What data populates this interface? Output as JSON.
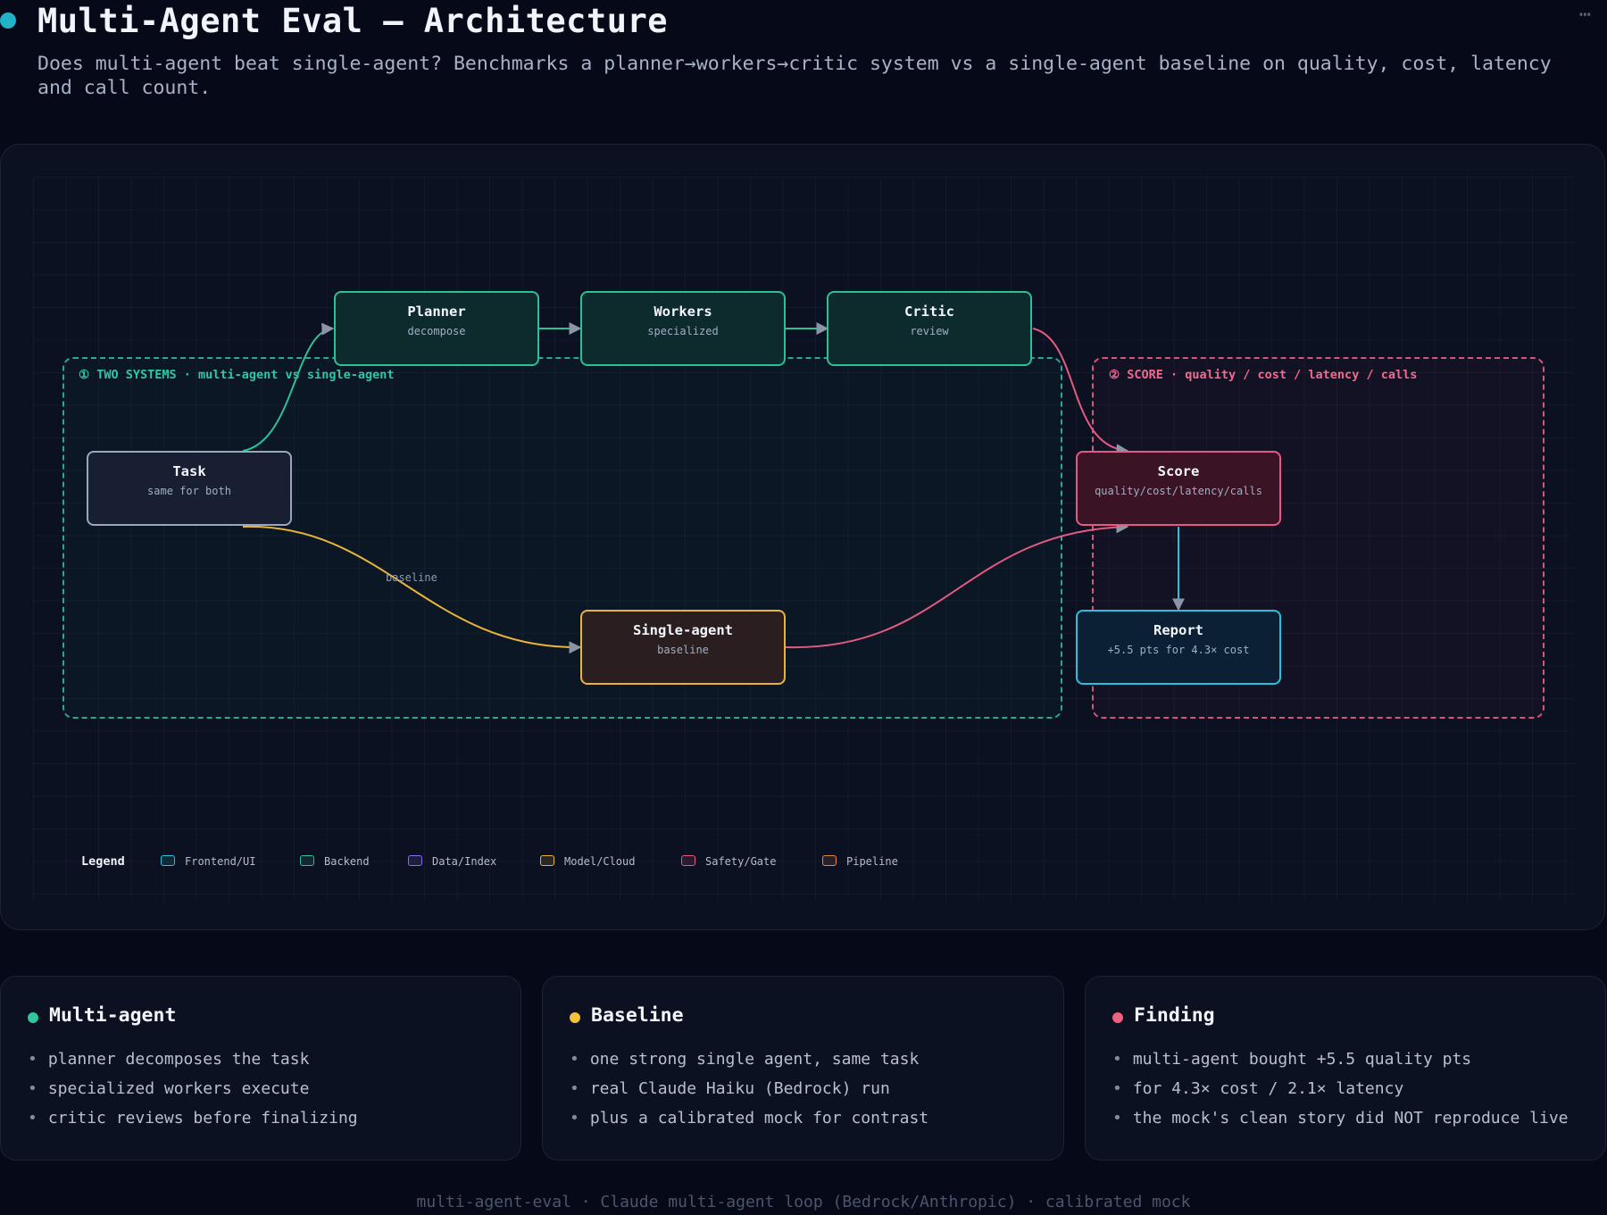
{
  "header": {
    "title": "Multi-Agent Eval — Architecture",
    "subtitle": "Does multi-agent beat single-agent? Benchmarks a planner→workers→critic system vs a single-agent baseline on quality, cost, latency and call count.",
    "more_icon": "⋯"
  },
  "zones": {
    "systems": "① TWO SYSTEMS · multi-agent vs single-agent",
    "score": "② SCORE · quality / cost / latency / calls"
  },
  "nodes": {
    "planner": {
      "title": "Planner",
      "sub": "decompose"
    },
    "workers": {
      "title": "Workers",
      "sub": "specialized"
    },
    "critic": {
      "title": "Critic",
      "sub": "review"
    },
    "task": {
      "title": "Task",
      "sub": "same for both"
    },
    "single": {
      "title": "Single-agent",
      "sub": "baseline"
    },
    "score": {
      "title": "Score",
      "sub": "quality/cost/latency/calls"
    },
    "report": {
      "title": "Report",
      "sub": "+5.5 pts for 4.3× cost"
    }
  },
  "edge_labels": {
    "baseline": "baseline"
  },
  "legend": {
    "title": "Legend",
    "items": [
      {
        "label": "Frontend/UI",
        "color": "#2bc0dd"
      },
      {
        "label": "Backend",
        "color": "#2fbf96"
      },
      {
        "label": "Data/Index",
        "color": "#8b6fe8"
      },
      {
        "label": "Model/Cloud",
        "color": "#e8b43a"
      },
      {
        "label": "Safety/Gate",
        "color": "#e55a80"
      },
      {
        "label": "Pipeline",
        "color": "#e08a4a"
      }
    ]
  },
  "cards": [
    {
      "title": "Multi-agent",
      "color": "#2fc7a0",
      "items": [
        "planner decomposes the task",
        "specialized workers execute",
        "critic reviews before finalizing"
      ]
    },
    {
      "title": "Baseline",
      "color": "#f2c43c",
      "items": [
        "one strong single agent, same task",
        "real Claude Haiku (Bedrock) run",
        "plus a calibrated mock for contrast"
      ]
    },
    {
      "title": "Finding",
      "color": "#f0607f",
      "items": [
        "multi-agent bought +5.5 quality pts",
        "for 4.3× cost / 2.1× latency",
        "the mock's clean story did NOT reproduce live"
      ]
    }
  ],
  "footer": "multi-agent-eval · Claude multi-agent loop (Bedrock/Anthropic) · calibrated mock"
}
